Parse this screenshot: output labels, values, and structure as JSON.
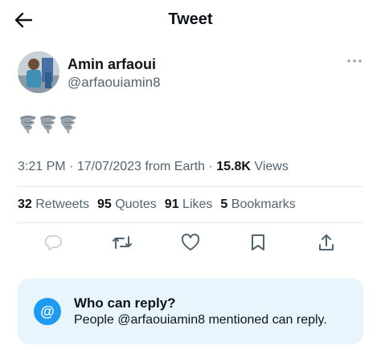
{
  "header": {
    "title": "Tweet"
  },
  "tweet": {
    "author_name": "Amin arfaoui",
    "author_handle": "@arfaouiamin8",
    "content_emoji": "🌪️🌪️🌪️",
    "time": "3:21 PM",
    "date": "17/07/2023",
    "source": "from Earth",
    "views_count": "15.8K",
    "views_label": "Views"
  },
  "stats": {
    "retweets_count": "32",
    "retweets_label": "Retweets",
    "quotes_count": "95",
    "quotes_label": "Quotes",
    "likes_count": "91",
    "likes_label": "Likes",
    "bookmarks_count": "5",
    "bookmarks_label": "Bookmarks"
  },
  "actions": [
    "reply-icon",
    "retweet-icon",
    "like-icon",
    "bookmark-icon",
    "share-icon"
  ],
  "reply_restriction": {
    "icon": "@",
    "title": "Who can reply?",
    "text": "People @arfaouiamin8 mentioned can reply."
  },
  "colors": {
    "accent": "#1d9bf0",
    "secondary_text": "#536471",
    "reply_box_bg": "#e8f5fd"
  }
}
